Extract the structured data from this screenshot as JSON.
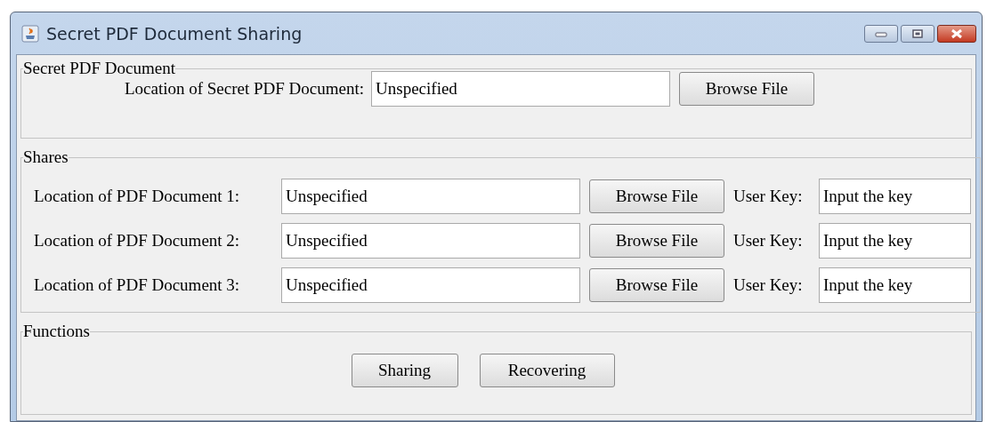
{
  "window": {
    "title": "Secret PDF Document Sharing"
  },
  "secret_document": {
    "title": "Secret PDF Document",
    "label": "Location of Secret PDF Document:",
    "value": "Unspecified",
    "button": "Browse File"
  },
  "shares": {
    "title": "Shares",
    "rows": [
      {
        "label": "Location of PDF Document 1:",
        "value": "Unspecified",
        "button": "Browse File",
        "key_label": "User Key:",
        "key_value": "Input the key"
      },
      {
        "label": "Location of PDF Document 2:",
        "value": "Unspecified",
        "button": "Browse File",
        "key_label": "User Key:",
        "key_value": "Input the key"
      },
      {
        "label": "Location of PDF Document 3:",
        "value": "Unspecified",
        "button": "Browse File",
        "key_label": "User Key:",
        "key_value": "Input the key"
      }
    ]
  },
  "functions": {
    "title": "Functions",
    "buttons": [
      "Sharing",
      "Recovering"
    ]
  }
}
